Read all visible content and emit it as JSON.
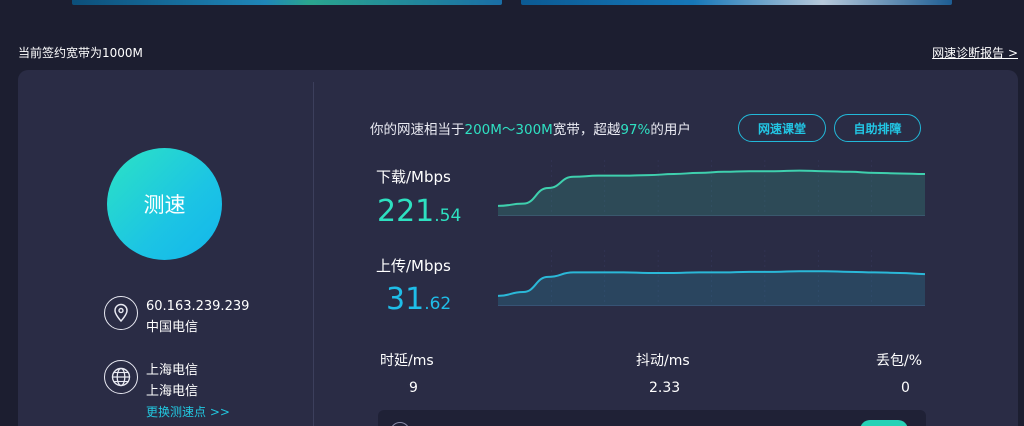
{
  "header": {
    "contract_text": "当前签约宽带为1000M",
    "report_link": "网速诊断报告 >"
  },
  "left_panel": {
    "speed_button_label": "测速",
    "ip": "60.163.239.239",
    "isp": "中国电信",
    "node_line1": "上海电信",
    "node_line2": "上海电信",
    "change_node_link": "更换测速点 >>"
  },
  "summary": {
    "prefix": "你的网速相当于",
    "range": "200M～300M",
    "middle": "宽带，超越",
    "percent": "97%",
    "suffix": "的用户"
  },
  "buttons": {
    "course": "网速课堂",
    "self_repair": "自助排障"
  },
  "download": {
    "label": "下载/Mbps",
    "value_int": "221",
    "value_dec": ".54",
    "trend": [
      0.18,
      0.22,
      0.5,
      0.7,
      0.72,
      0.72,
      0.73,
      0.75,
      0.77,
      0.79,
      0.8,
      0.8,
      0.81,
      0.8,
      0.79,
      0.77,
      0.76,
      0.75
    ]
  },
  "upload": {
    "label": "上传/Mbps",
    "value_int": "31",
    "value_dec": ".62",
    "trend": [
      0.18,
      0.25,
      0.52,
      0.6,
      0.6,
      0.6,
      0.59,
      0.59,
      0.6,
      0.6,
      0.61,
      0.61,
      0.62,
      0.62,
      0.61,
      0.6,
      0.59,
      0.57
    ]
  },
  "stats": {
    "latency_label": "时延/ms",
    "latency_value": "9",
    "jitter_label": "抖动/ms",
    "jitter_value": "2.33",
    "loss_label": "丢包/%",
    "loss_value": "0"
  },
  "colors": {
    "background": "#1c1e30",
    "card": "#2a2c45",
    "accent_green": "#2ee0c0",
    "accent_blue": "#1fbde8",
    "download_line": "#3fd0ae",
    "upload_line": "#2bb8d8"
  },
  "icons": {
    "location": "location-pin-icon",
    "globe": "globe-icon"
  }
}
